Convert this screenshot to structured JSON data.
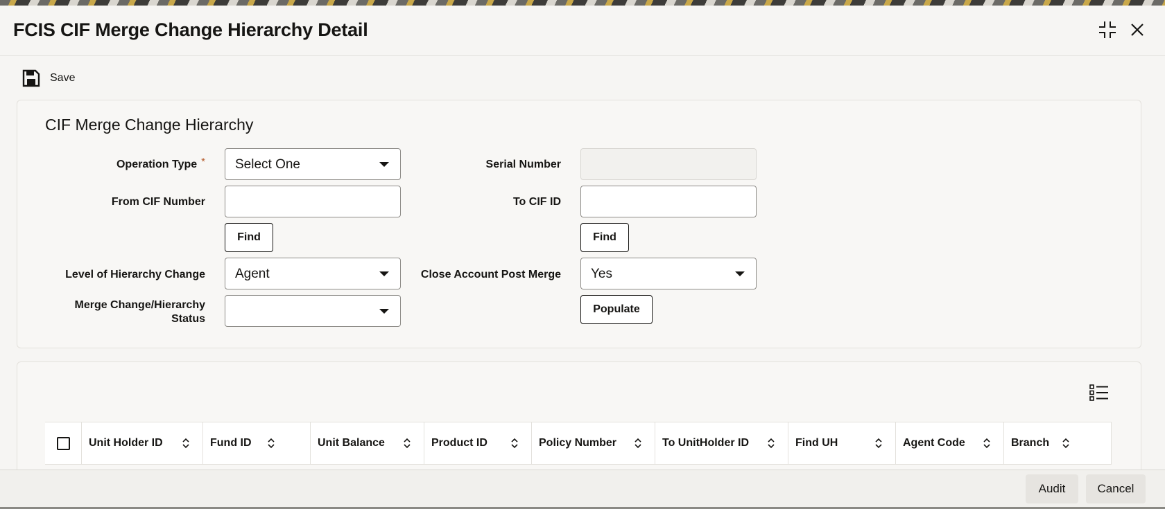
{
  "window": {
    "title": "FCIS CIF Merge Change Hierarchy Detail",
    "maximize_icon": "maximize-icon",
    "close_icon": "close-icon"
  },
  "toolbar": {
    "save_label": "Save",
    "save_icon": "floppy-disk-icon"
  },
  "form": {
    "section_title": "CIF Merge Change Hierarchy",
    "operation_type": {
      "label": "Operation Type",
      "required_mark": "*",
      "value": "Select One"
    },
    "serial_number": {
      "label": "Serial Number",
      "value": ""
    },
    "from_cif_number": {
      "label": "From CIF Number",
      "value": "",
      "find_label": "Find"
    },
    "to_cif_id": {
      "label": "To CIF ID",
      "value": "",
      "find_label": "Find"
    },
    "level_of_hierarchy_change": {
      "label": "Level of Hierarchy Change",
      "value": "Agent"
    },
    "close_account_post_merge": {
      "label": "Close Account Post Merge",
      "value": "Yes"
    },
    "merge_status": {
      "label_line1": "Merge Change/Hierarchy",
      "label_line2": "Status",
      "value": ""
    },
    "populate_label": "Populate"
  },
  "grid": {
    "settings_icon": "list-settings-icon",
    "columns": [
      "Unit Holder ID",
      "Fund ID",
      "Unit Balance",
      "Product ID",
      "Policy Number",
      "To UnitHolder ID",
      "Find UH",
      "Agent Code",
      "Branch"
    ]
  },
  "footer": {
    "audit_label": "Audit",
    "cancel_label": "Cancel"
  }
}
